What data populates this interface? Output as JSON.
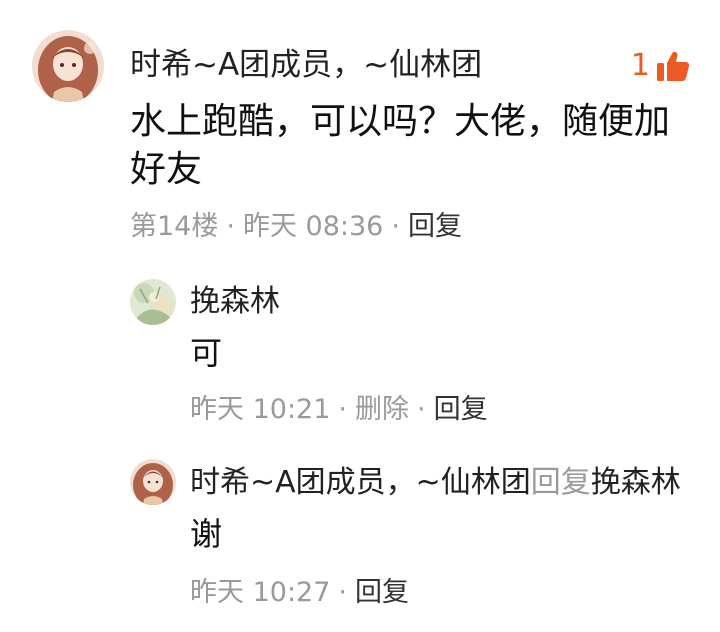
{
  "main_comment": {
    "username": "时希~A团成员，~仙林团",
    "like_count": "1",
    "text": "水上跑酷，可以吗？大佬，随便加好友",
    "floor": "第14楼",
    "time": "昨天 08:36",
    "reply_label": "回复",
    "separator": "·"
  },
  "replies": [
    {
      "username": "挽森林",
      "text": "可",
      "time": "昨天 10:21",
      "delete_label": "删除",
      "reply_label": "回复"
    },
    {
      "username": "时希~A团成员，~仙林团",
      "reply_to_label": "回复",
      "reply_to_user": "挽森林",
      "text": "谢",
      "time": "昨天 10:27",
      "reply_label": "回复"
    }
  ],
  "colors": {
    "like_accent": "#ee5a24",
    "meta_gray": "#9a9a9a",
    "text_dark": "#111111"
  },
  "icons": {
    "like": "thumbs-up-icon"
  }
}
